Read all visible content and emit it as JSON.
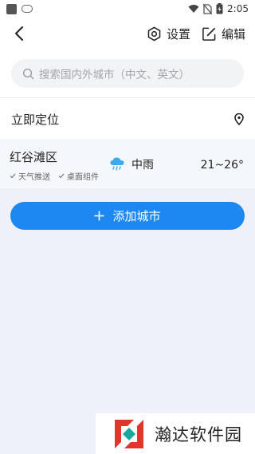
{
  "status_bar": {
    "time": "2:05"
  },
  "header": {
    "settings_label": "设置",
    "edit_label": "编辑"
  },
  "search": {
    "placeholder": "搜索国内外城市（中文、英文）"
  },
  "locate": {
    "label": "立即定位"
  },
  "city_list": [
    {
      "name": "红谷滩区",
      "tags": [
        "天气推送",
        "桌面组件"
      ],
      "weather": "中雨",
      "temp": "21~26°"
    }
  ],
  "add_button": {
    "label": "添加城市"
  },
  "watermark": {
    "text": "瀚达软件园"
  },
  "colors": {
    "accent": "#1d88f2",
    "weather_icon": "#3fa8ea",
    "logo_red": "#e0362c",
    "logo_teal": "#1aa79c"
  }
}
